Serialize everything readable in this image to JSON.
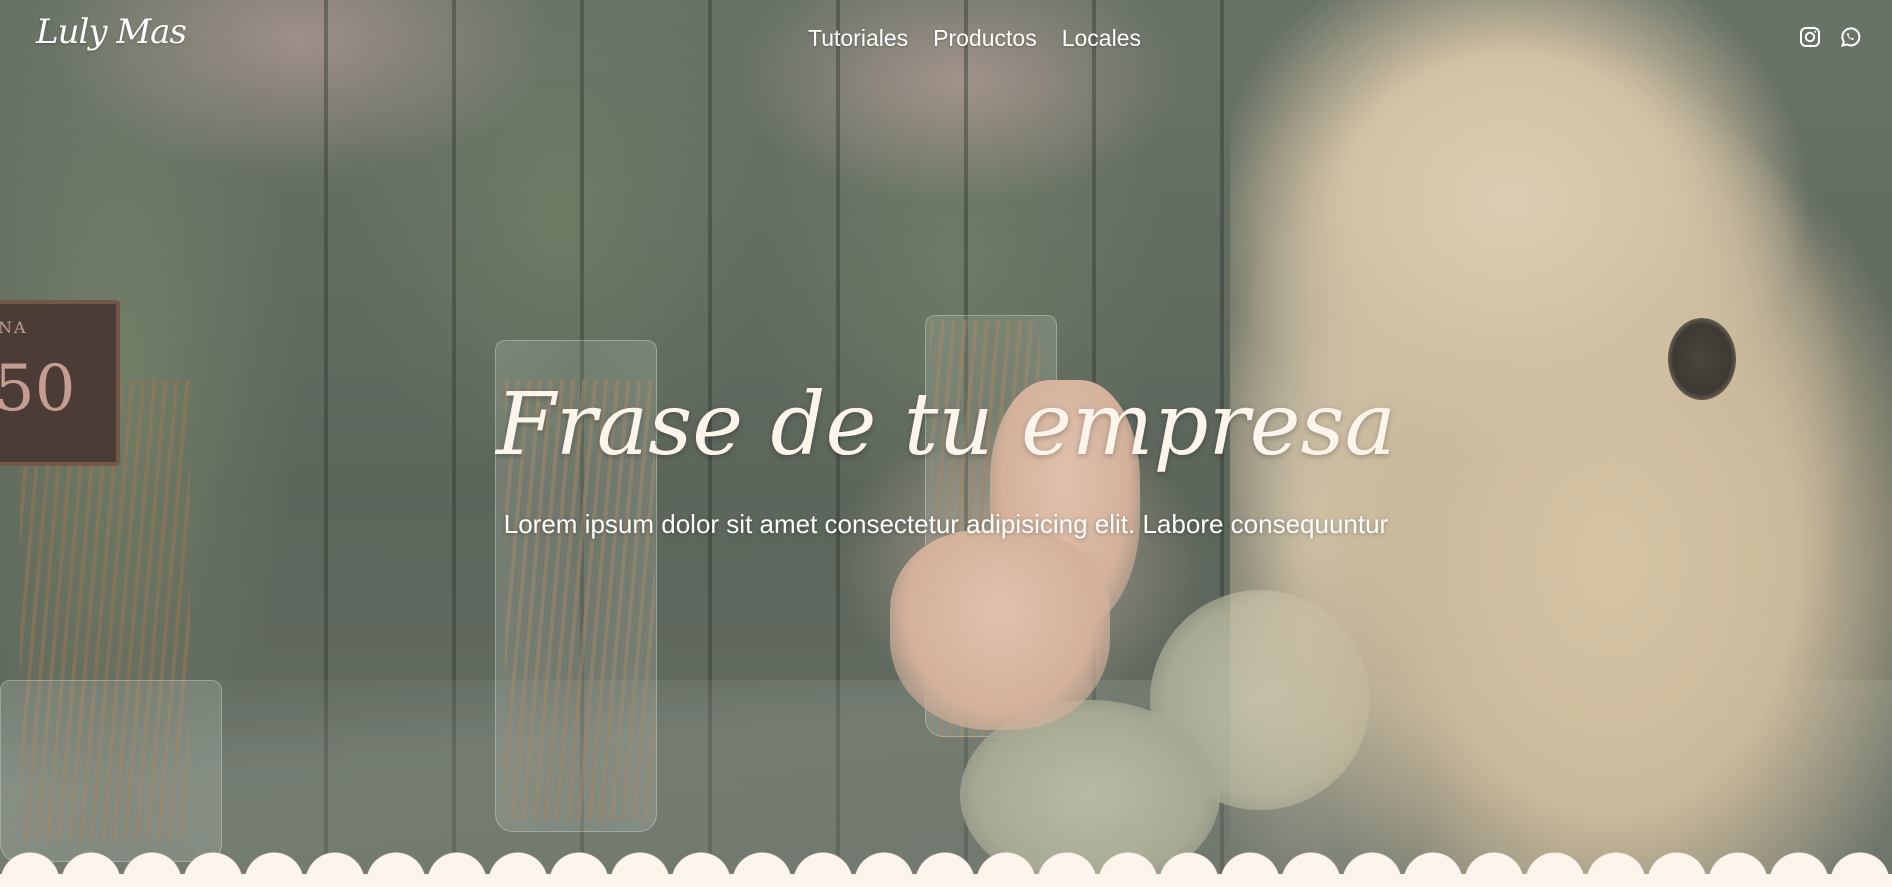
{
  "header": {
    "logo_text": "Luly Mas",
    "nav": [
      {
        "label": "Tutoriales"
      },
      {
        "label": "Productos"
      },
      {
        "label": "Locales"
      }
    ],
    "social": [
      {
        "icon": "instagram-icon"
      },
      {
        "icon": "whatsapp-icon"
      }
    ]
  },
  "hero": {
    "headline": "Frase de tu empresa",
    "subtitle": "Lorem ipsum dolor sit amet consectetur adipisicing elit. Labore consequuntur",
    "sign": {
      "line1": "NA",
      "line2": "50"
    }
  },
  "colors": {
    "text": "#ffffff",
    "cream": "#fdf4ec"
  }
}
